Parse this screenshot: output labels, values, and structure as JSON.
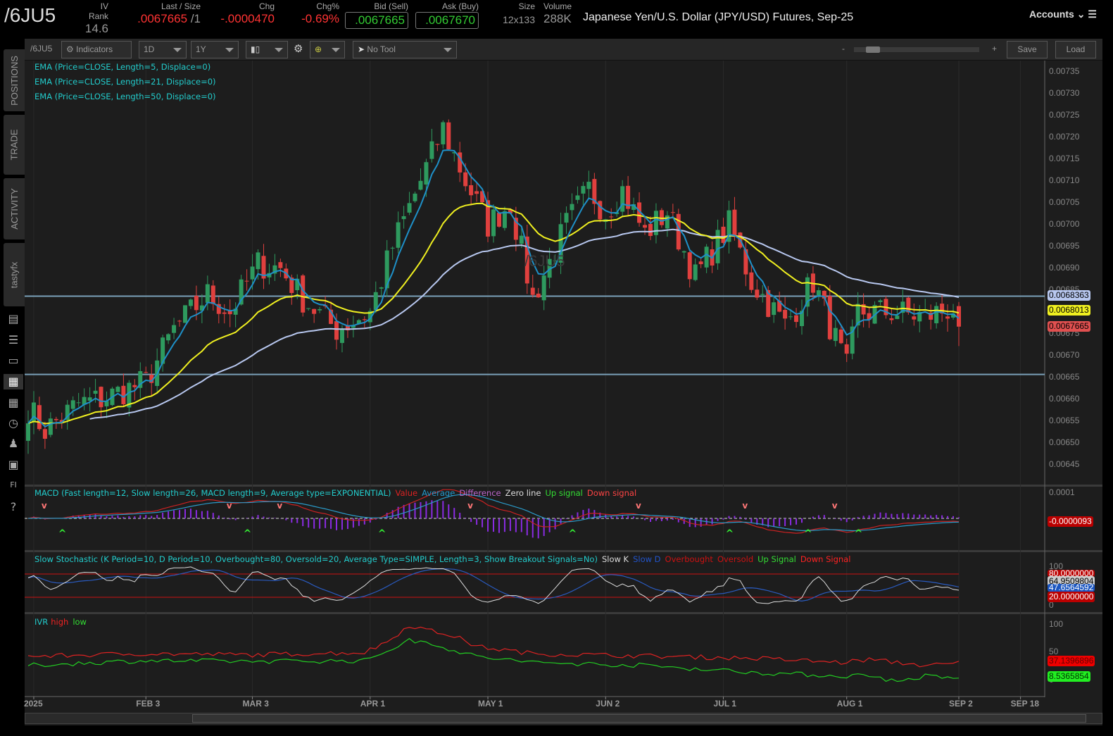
{
  "header": {
    "symbol": "/6JU5",
    "iv_rank_label": "IV Rank",
    "iv_rank": "14.6",
    "last_label": "Last / Size",
    "last": ".0067665",
    "last_size": "/1",
    "chg_label": "Chg",
    "chg": "-.0000470",
    "chgpct_label": "Chg%",
    "chgpct": "-0.69%",
    "bid_label": "Bid (Sell)",
    "bid": ".0067665",
    "ask_label": "Ask (Buy)",
    "ask": ".0067670",
    "size_label": "Size",
    "size": "12x133",
    "volume_label": "Volume",
    "volume": "288K",
    "description": "Japanese Yen/U.S. Dollar (JPY/USD) Futures, Sep-25",
    "accounts": "Accounts"
  },
  "sidebar": {
    "tabs": [
      "POSITIONS",
      "TRADE",
      "ACTIVITY",
      "tastyfx"
    ],
    "icons": [
      "chart-news-icon",
      "list-icon",
      "tv-icon",
      "chart-grid-icon",
      "layout-icon",
      "clock-icon",
      "community-icon",
      "calendar-icon",
      "fi-icon",
      "help-icon"
    ]
  },
  "toolbar": {
    "symbol": "/6JU5",
    "indicators": "Indicators",
    "aggregation": "1D",
    "range": "1Y",
    "chart_type": "candles",
    "drawing": "No Tool",
    "zoom_minus": "-",
    "zoom_plus": "+",
    "save": "Save",
    "load": "Load"
  },
  "legends": {
    "ema5": "EMA (Price=CLOSE, Length=5, Displace=0)",
    "ema21": "EMA (Price=CLOSE, Length=21, Displace=0)",
    "ema50": "EMA (Price=CLOSE, Length=50, Displace=0)",
    "macd": "MACD (Fast length=12, Slow length=26, MACD length=9, Average type=EXPONENTIAL)",
    "macd_items": [
      "Value",
      "Average",
      "Difference",
      "Zero line",
      "Up signal",
      "Down signal"
    ],
    "stoch": "Slow Stochastic (K Period=10, D Period=10, Overbought=80, Oversold=20, Average Type=SIMPLE, Length=3, Show Breakout Signals=No)",
    "stoch_items": [
      "Slow K",
      "Slow D",
      "Overbought",
      "Oversold",
      "Up Signal",
      "Down Signal"
    ],
    "ivr": "IVR",
    "ivr_items": [
      "high",
      "low"
    ]
  },
  "watermark": "/6JU5",
  "colors": {
    "up": "#2e9a5e",
    "down": "#e0403e",
    "ema5": "#1e90c8",
    "ema21": "#f0f020",
    "ema50": "#b8c8f0",
    "bg": "#1d1d1d"
  },
  "badges": {
    "ema50": "0.0068363",
    "ema21": "0.0068013",
    "last": "0.0067665",
    "macd": "-0.0000093",
    "stoch_ob": "80.0000000",
    "stoch_k": "64.9509804",
    "stoch_d": "47.6564592",
    "stoch_os": "20.0000000",
    "ivr_high": "37.1396896",
    "ivr_low": "8.5365854"
  },
  "chart_data": {
    "type": "candlestick",
    "title": "/6JU5 1D 1Y",
    "price_ticks": [
      "0.00735",
      "0.00730",
      "0.00725",
      "0.00720",
      "0.00715",
      "0.00710",
      "0.00705",
      "0.00700",
      "0.00695",
      "0.00690",
      "0.00685",
      "0.00680",
      "0.00675",
      "0.00670",
      "0.00665",
      "0.00660",
      "0.00655",
      "0.00650",
      "0.00645"
    ],
    "ylim": [
      0.00643,
      0.00738
    ],
    "x_ticks": [
      "2025",
      "FEB 3",
      "MAR 3",
      "APR 1",
      "MAY 1",
      "JUN 2",
      "JUL 1",
      "AUG 1",
      "SEP 2",
      "SEP 18"
    ],
    "x_tick_days": [
      1,
      21,
      40,
      61,
      82,
      103,
      124,
      146,
      166,
      177
    ],
    "n_days": 167,
    "close_anchors": [
      [
        0,
        0.00658
      ],
      [
        3,
        0.00653
      ],
      [
        9,
        0.00659
      ],
      [
        13,
        0.0066
      ],
      [
        21,
        0.00664
      ],
      [
        26,
        0.00676
      ],
      [
        32,
        0.00684
      ],
      [
        36,
        0.0068
      ],
      [
        41,
        0.00691
      ],
      [
        45,
        0.0069
      ],
      [
        49,
        0.00683
      ],
      [
        55,
        0.00676
      ],
      [
        61,
        0.0068
      ],
      [
        65,
        0.00695
      ],
      [
        70,
        0.0071
      ],
      [
        74,
        0.00722
      ],
      [
        78,
        0.0071
      ],
      [
        82,
        0.007
      ],
      [
        86,
        0.00705
      ],
      [
        90,
        0.00683
      ],
      [
        96,
        0.007
      ],
      [
        100,
        0.00708
      ],
      [
        103,
        0.00703
      ],
      [
        106,
        0.00708
      ],
      [
        110,
        0.00698
      ],
      [
        114,
        0.00703
      ],
      [
        119,
        0.00688
      ],
      [
        125,
        0.007
      ],
      [
        129,
        0.00687
      ],
      [
        135,
        0.00677
      ],
      [
        140,
        0.00687
      ],
      [
        146,
        0.00667
      ],
      [
        148,
        0.0068
      ],
      [
        154,
        0.0068
      ],
      [
        160,
        0.00679
      ],
      [
        165,
        0.00681
      ],
      [
        166,
        0.0067665
      ]
    ],
    "hlines": [
      0.0068363,
      0.006657
    ],
    "macd_ylim": [
      -8e-05,
      0.0001
    ],
    "macd_tick": "0.0001",
    "stoch_ticks": [
      "100",
      "0"
    ],
    "ivr_ticks": [
      "100",
      "50",
      "0"
    ],
    "ivr_high_anchors": [
      [
        0,
        45
      ],
      [
        20,
        50
      ],
      [
        40,
        48
      ],
      [
        60,
        52
      ],
      [
        64,
        70
      ],
      [
        68,
        98
      ],
      [
        72,
        88
      ],
      [
        76,
        80
      ],
      [
        80,
        62
      ],
      [
        90,
        50
      ],
      [
        110,
        46
      ],
      [
        130,
        42
      ],
      [
        145,
        35
      ],
      [
        150,
        40
      ],
      [
        160,
        30
      ],
      [
        165,
        32
      ],
      [
        166,
        37.14
      ]
    ],
    "ivr_low_anchors": [
      [
        0,
        30
      ],
      [
        20,
        38
      ],
      [
        40,
        37
      ],
      [
        60,
        38
      ],
      [
        64,
        55
      ],
      [
        68,
        72
      ],
      [
        72,
        68
      ],
      [
        76,
        55
      ],
      [
        80,
        45
      ],
      [
        90,
        35
      ],
      [
        110,
        30
      ],
      [
        130,
        18
      ],
      [
        145,
        12
      ],
      [
        150,
        14
      ],
      [
        155,
        2
      ],
      [
        160,
        12
      ],
      [
        165,
        8
      ],
      [
        166,
        8.54
      ]
    ]
  }
}
